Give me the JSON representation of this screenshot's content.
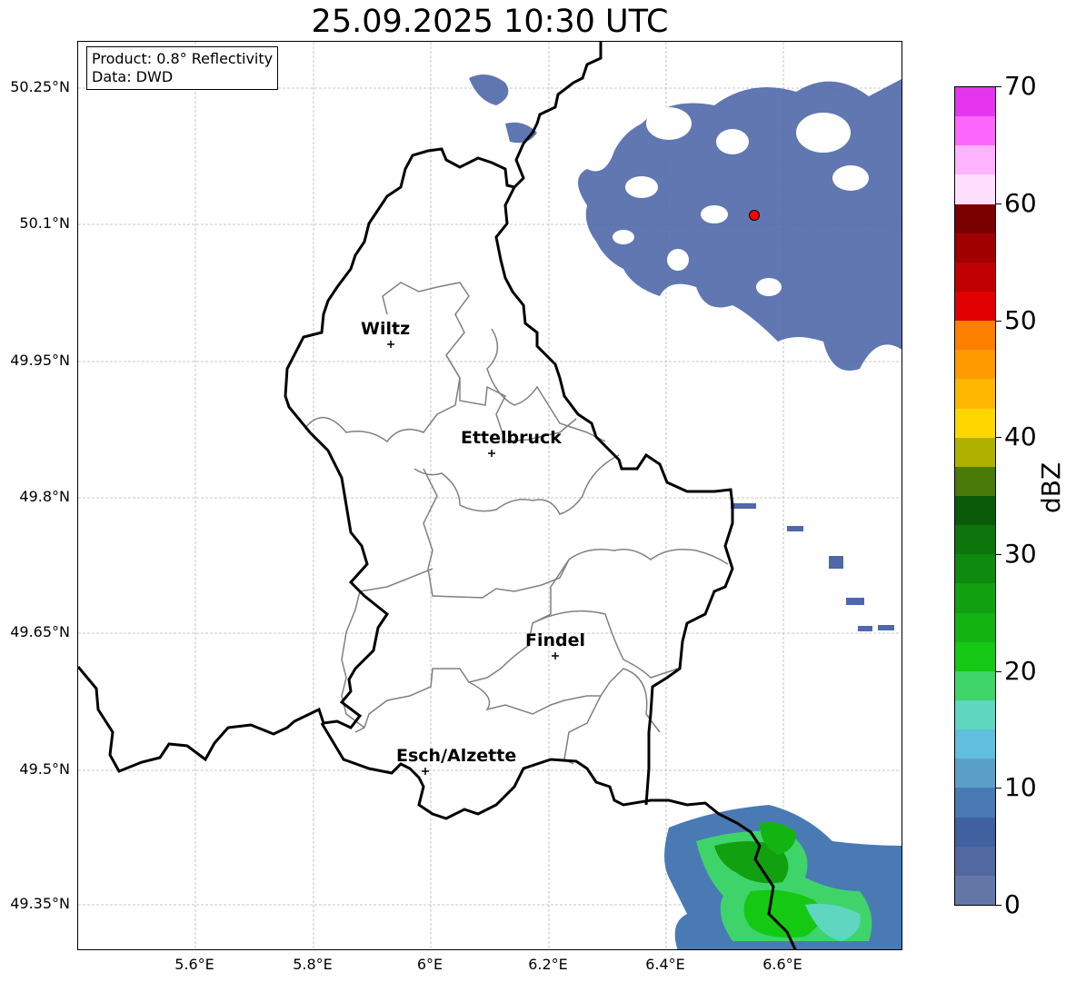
{
  "title": "25.09.2025 10:30 UTC",
  "info": {
    "product": "Product: 0.8° Reflectivity",
    "data": "Data: DWD"
  },
  "axes": {
    "lat_labels": [
      "50.25°N",
      "50.1°N",
      "49.95°N",
      "49.8°N",
      "49.65°N",
      "49.5°N",
      "49.35°N"
    ],
    "lon_labels": [
      "5.6°E",
      "5.8°E",
      "6°E",
      "6.2°E",
      "6.4°E",
      "6.6°E"
    ]
  },
  "cities": [
    {
      "name": "Wiltz"
    },
    {
      "name": "Ettelbruck"
    },
    {
      "name": "Findel"
    },
    {
      "name": "Esch/Alzette"
    }
  ],
  "colorbar": {
    "label": "dBZ",
    "ticks": [
      "0",
      "10",
      "20",
      "30",
      "40",
      "50",
      "60",
      "70"
    ],
    "colors": [
      "#e535ee",
      "#fd66fb",
      "#feb3fe",
      "#fee0fe",
      "#7a0000",
      "#a00000",
      "#c00000",
      "#e00000",
      "#ff7f00",
      "#ff9b00",
      "#ffb700",
      "#ffd700",
      "#b0b000",
      "#4a7a0a",
      "#0a5a0a",
      "#0c760c",
      "#0e8a0e",
      "#10a010",
      "#12b412",
      "#14c814",
      "#3ed46a",
      "#5ed6c0",
      "#5fbfdc",
      "#5a9fc8",
      "#4a7ab4",
      "#4060a0",
      "#5268a0",
      "#6478a8"
    ]
  },
  "colors": {
    "country_border": "#000000",
    "canton_border": "#808080",
    "grid": "#b0b0b0",
    "radar_site": "#ff0000"
  }
}
